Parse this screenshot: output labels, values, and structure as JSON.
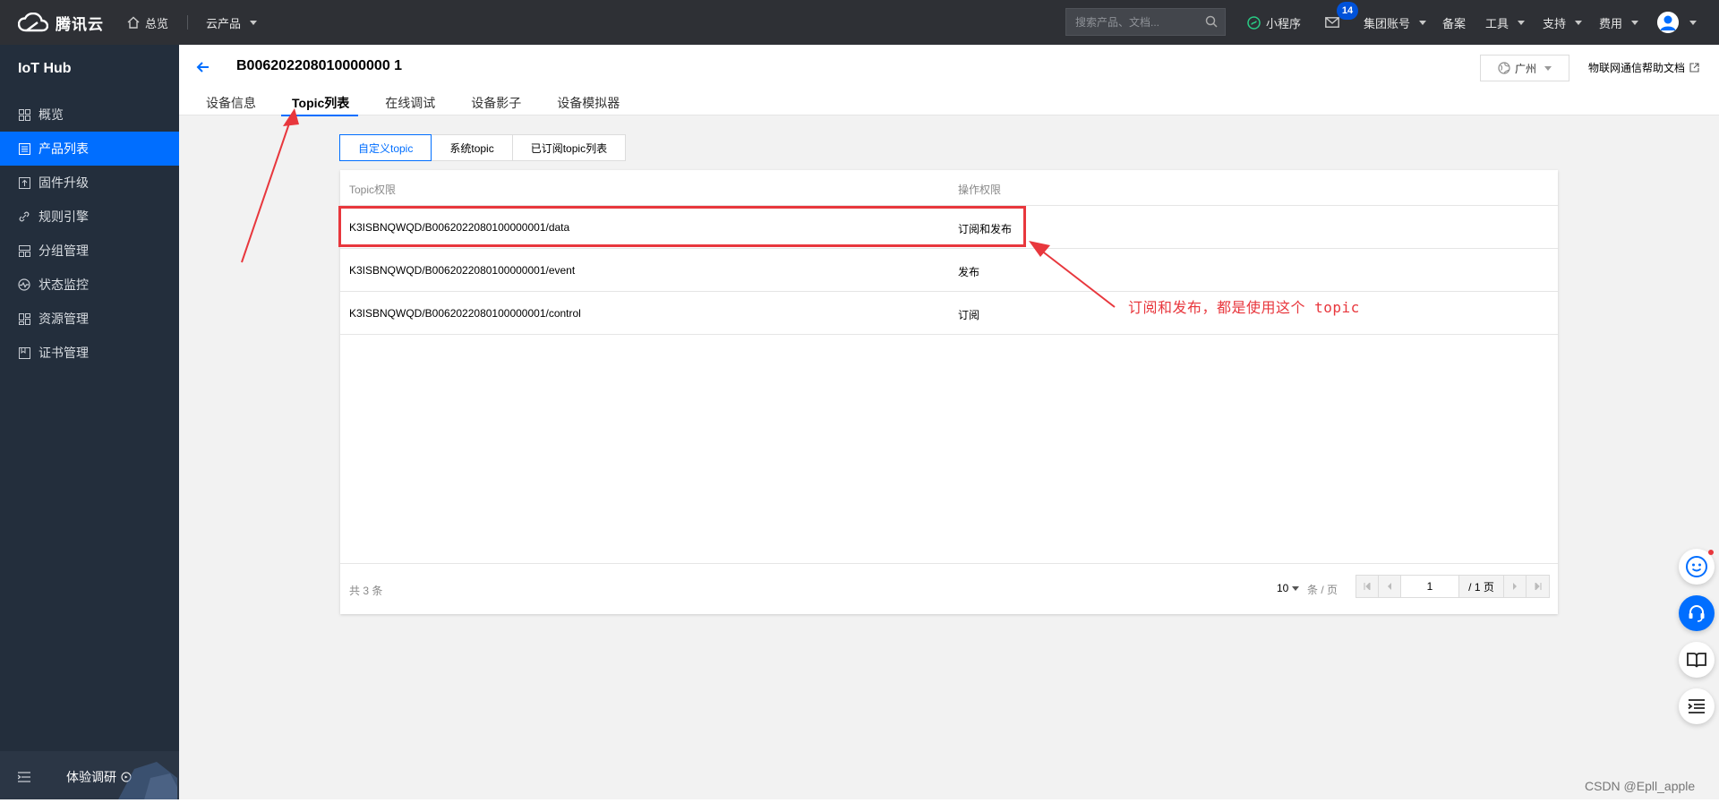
{
  "topnav": {
    "brand": "腾讯云",
    "overview": "总览",
    "products": "云产品",
    "search_placeholder": "搜索产品、文档...",
    "miniprogram": "小程序",
    "mail_count": "14",
    "group_account": "集团账号",
    "filing": "备案",
    "tools": "工具",
    "support": "支持",
    "billing": "费用"
  },
  "sidebar": {
    "title": "IoT Hub",
    "items": [
      {
        "label": "概览",
        "icon": "grid-icon"
      },
      {
        "label": "产品列表",
        "icon": "list-icon"
      },
      {
        "label": "固件升级",
        "icon": "upload-icon"
      },
      {
        "label": "规则引擎",
        "icon": "link-icon"
      },
      {
        "label": "分组管理",
        "icon": "group-icon"
      },
      {
        "label": "状态监控",
        "icon": "monitor-icon"
      },
      {
        "label": "资源管理",
        "icon": "resource-icon"
      },
      {
        "label": "证书管理",
        "icon": "certificate-icon"
      }
    ],
    "active_index": 1,
    "survey": "体验调研"
  },
  "header": {
    "device_name": "B006202208010000000 1",
    "region": "广州",
    "doc_link": "物联网通信帮助文档",
    "tabs": [
      "设备信息",
      "Topic列表",
      "在线调试",
      "设备影子",
      "设备模拟器"
    ],
    "active_tab": 1
  },
  "subtabs": {
    "items": [
      "自定义topic",
      "系统topic",
      "已订阅topic列表"
    ],
    "active": 0
  },
  "table": {
    "columns": [
      "Topic权限",
      "操作权限"
    ],
    "rows": [
      {
        "topic": "K3ISBNQWQD/B0062022080100000001/data",
        "permission": "订阅和发布"
      },
      {
        "topic": "K3ISBNQWQD/B0062022080100000001/event",
        "permission": "发布"
      },
      {
        "topic": "K3ISBNQWQD/B0062022080100000001/control",
        "permission": "订阅"
      }
    ],
    "total_text": "共 3 条",
    "page_size": "10",
    "page_size_unit": "条 / 页",
    "current_page": "1",
    "total_pages": "/ 1 页"
  },
  "annotation": {
    "note": "订阅和发布，都是使用这个 topic",
    "color": "#e8373d"
  },
  "watermark": "CSDN @Epll_apple",
  "colors": {
    "accent": "#006eff",
    "topbar": "#2e3035",
    "sidebar": "#232e3c"
  }
}
